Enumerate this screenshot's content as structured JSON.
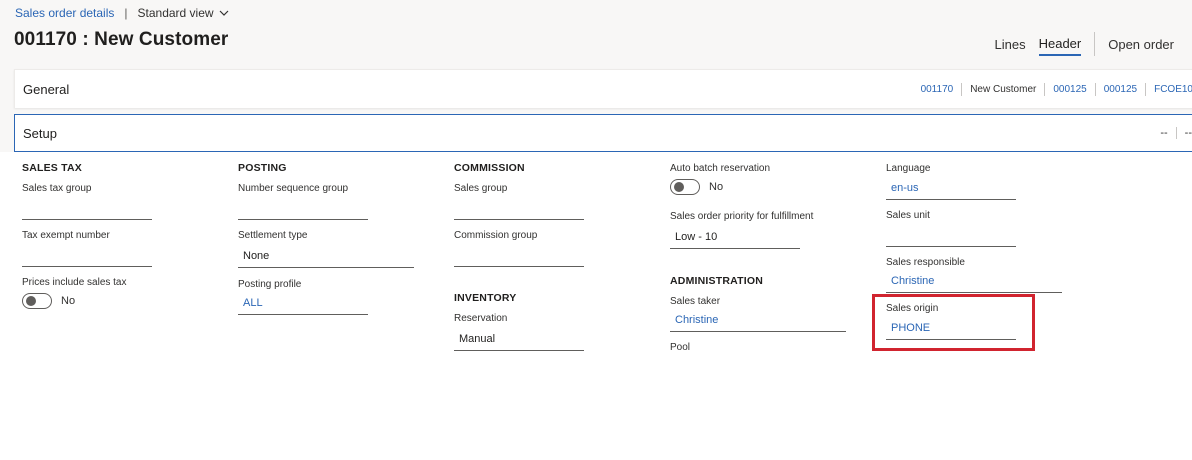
{
  "breadcrumb": {
    "link": "Sales order details",
    "separator": "|",
    "view": "Standard view"
  },
  "title": "001170 : New Customer",
  "view_tabs": {
    "lines": "Lines",
    "header": "Header",
    "open_order": "Open order"
  },
  "general": {
    "title": "General",
    "summary": [
      "001170",
      "New Customer",
      "000125",
      "000125",
      "FCOE10"
    ]
  },
  "setup": {
    "title": "Setup",
    "summary": [
      "--",
      "--"
    ],
    "sales_tax": {
      "heading": "SALES TAX",
      "sales_tax_group_label": "Sales tax group",
      "sales_tax_group_value": "",
      "tax_exempt_label": "Tax exempt number",
      "tax_exempt_value": "",
      "prices_include_label": "Prices include sales tax",
      "prices_include_value": "No"
    },
    "posting": {
      "heading": "POSTING",
      "number_sequence_label": "Number sequence group",
      "number_sequence_value": "",
      "settlement_label": "Settlement type",
      "settlement_value": "None",
      "posting_profile_label": "Posting profile",
      "posting_profile_value": "ALL"
    },
    "commission": {
      "heading": "COMMISSION",
      "sales_group_label": "Sales group",
      "sales_group_value": "",
      "commission_group_label": "Commission group",
      "commission_group_value": ""
    },
    "inventory": {
      "heading": "INVENTORY",
      "reservation_label": "Reservation",
      "reservation_value": "Manual"
    },
    "fulfillment": {
      "auto_batch_label": "Auto batch reservation",
      "auto_batch_value": "No",
      "priority_label": "Sales order priority for fulfillment",
      "priority_value": "Low - 10"
    },
    "administration": {
      "heading": "ADMINISTRATION",
      "sales_taker_label": "Sales taker",
      "sales_taker_value": "Christine",
      "pool_label": "Pool"
    },
    "other": {
      "language_label": "Language",
      "language_value": "en-us",
      "sales_unit_label": "Sales unit",
      "sales_unit_value": "",
      "sales_responsible_label": "Sales responsible",
      "sales_responsible_value": "Christine",
      "sales_origin_label": "Sales origin",
      "sales_origin_value": "PHONE"
    }
  },
  "colors": {
    "link": "#2b66b5",
    "highlight": "#d1242f",
    "focus_border": "#2b66b5"
  }
}
